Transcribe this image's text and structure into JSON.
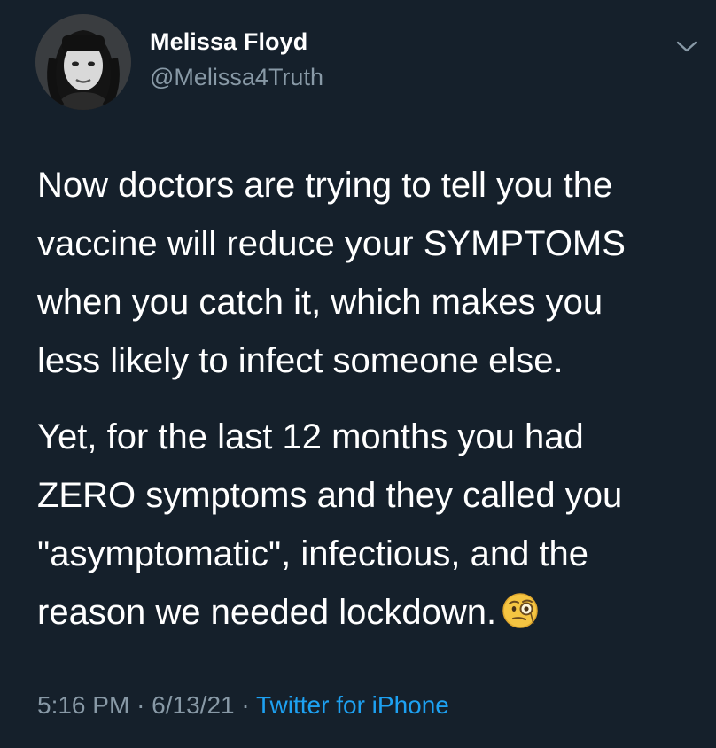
{
  "tweet": {
    "display_name": "Melissa Floyd",
    "handle": "@Melissa4Truth",
    "menu_icon": "chevron-down-icon",
    "avatar_icon": "profile-photo",
    "paragraphs": [
      {
        "lines": [
          "Now doctors are trying to tell you the",
          "vaccine will reduce your SYMPTOMS",
          "when you catch it, which makes you",
          "less likely to infect someone else."
        ]
      },
      {
        "lines": [
          "Yet, for the last 12 months you had",
          "ZERO symptoms and they called you",
          "\"asymptomatic\", infectious, and the",
          "reason we needed lockdown."
        ]
      }
    ],
    "emoji": "face-with-monocle-icon",
    "time": "5:16 PM",
    "date": "6/13/21",
    "separator": "·",
    "source": "Twitter for iPhone"
  },
  "colors": {
    "background": "#15202b",
    "text": "#ffffff",
    "muted": "#8899a6",
    "link": "#1da1f2"
  }
}
